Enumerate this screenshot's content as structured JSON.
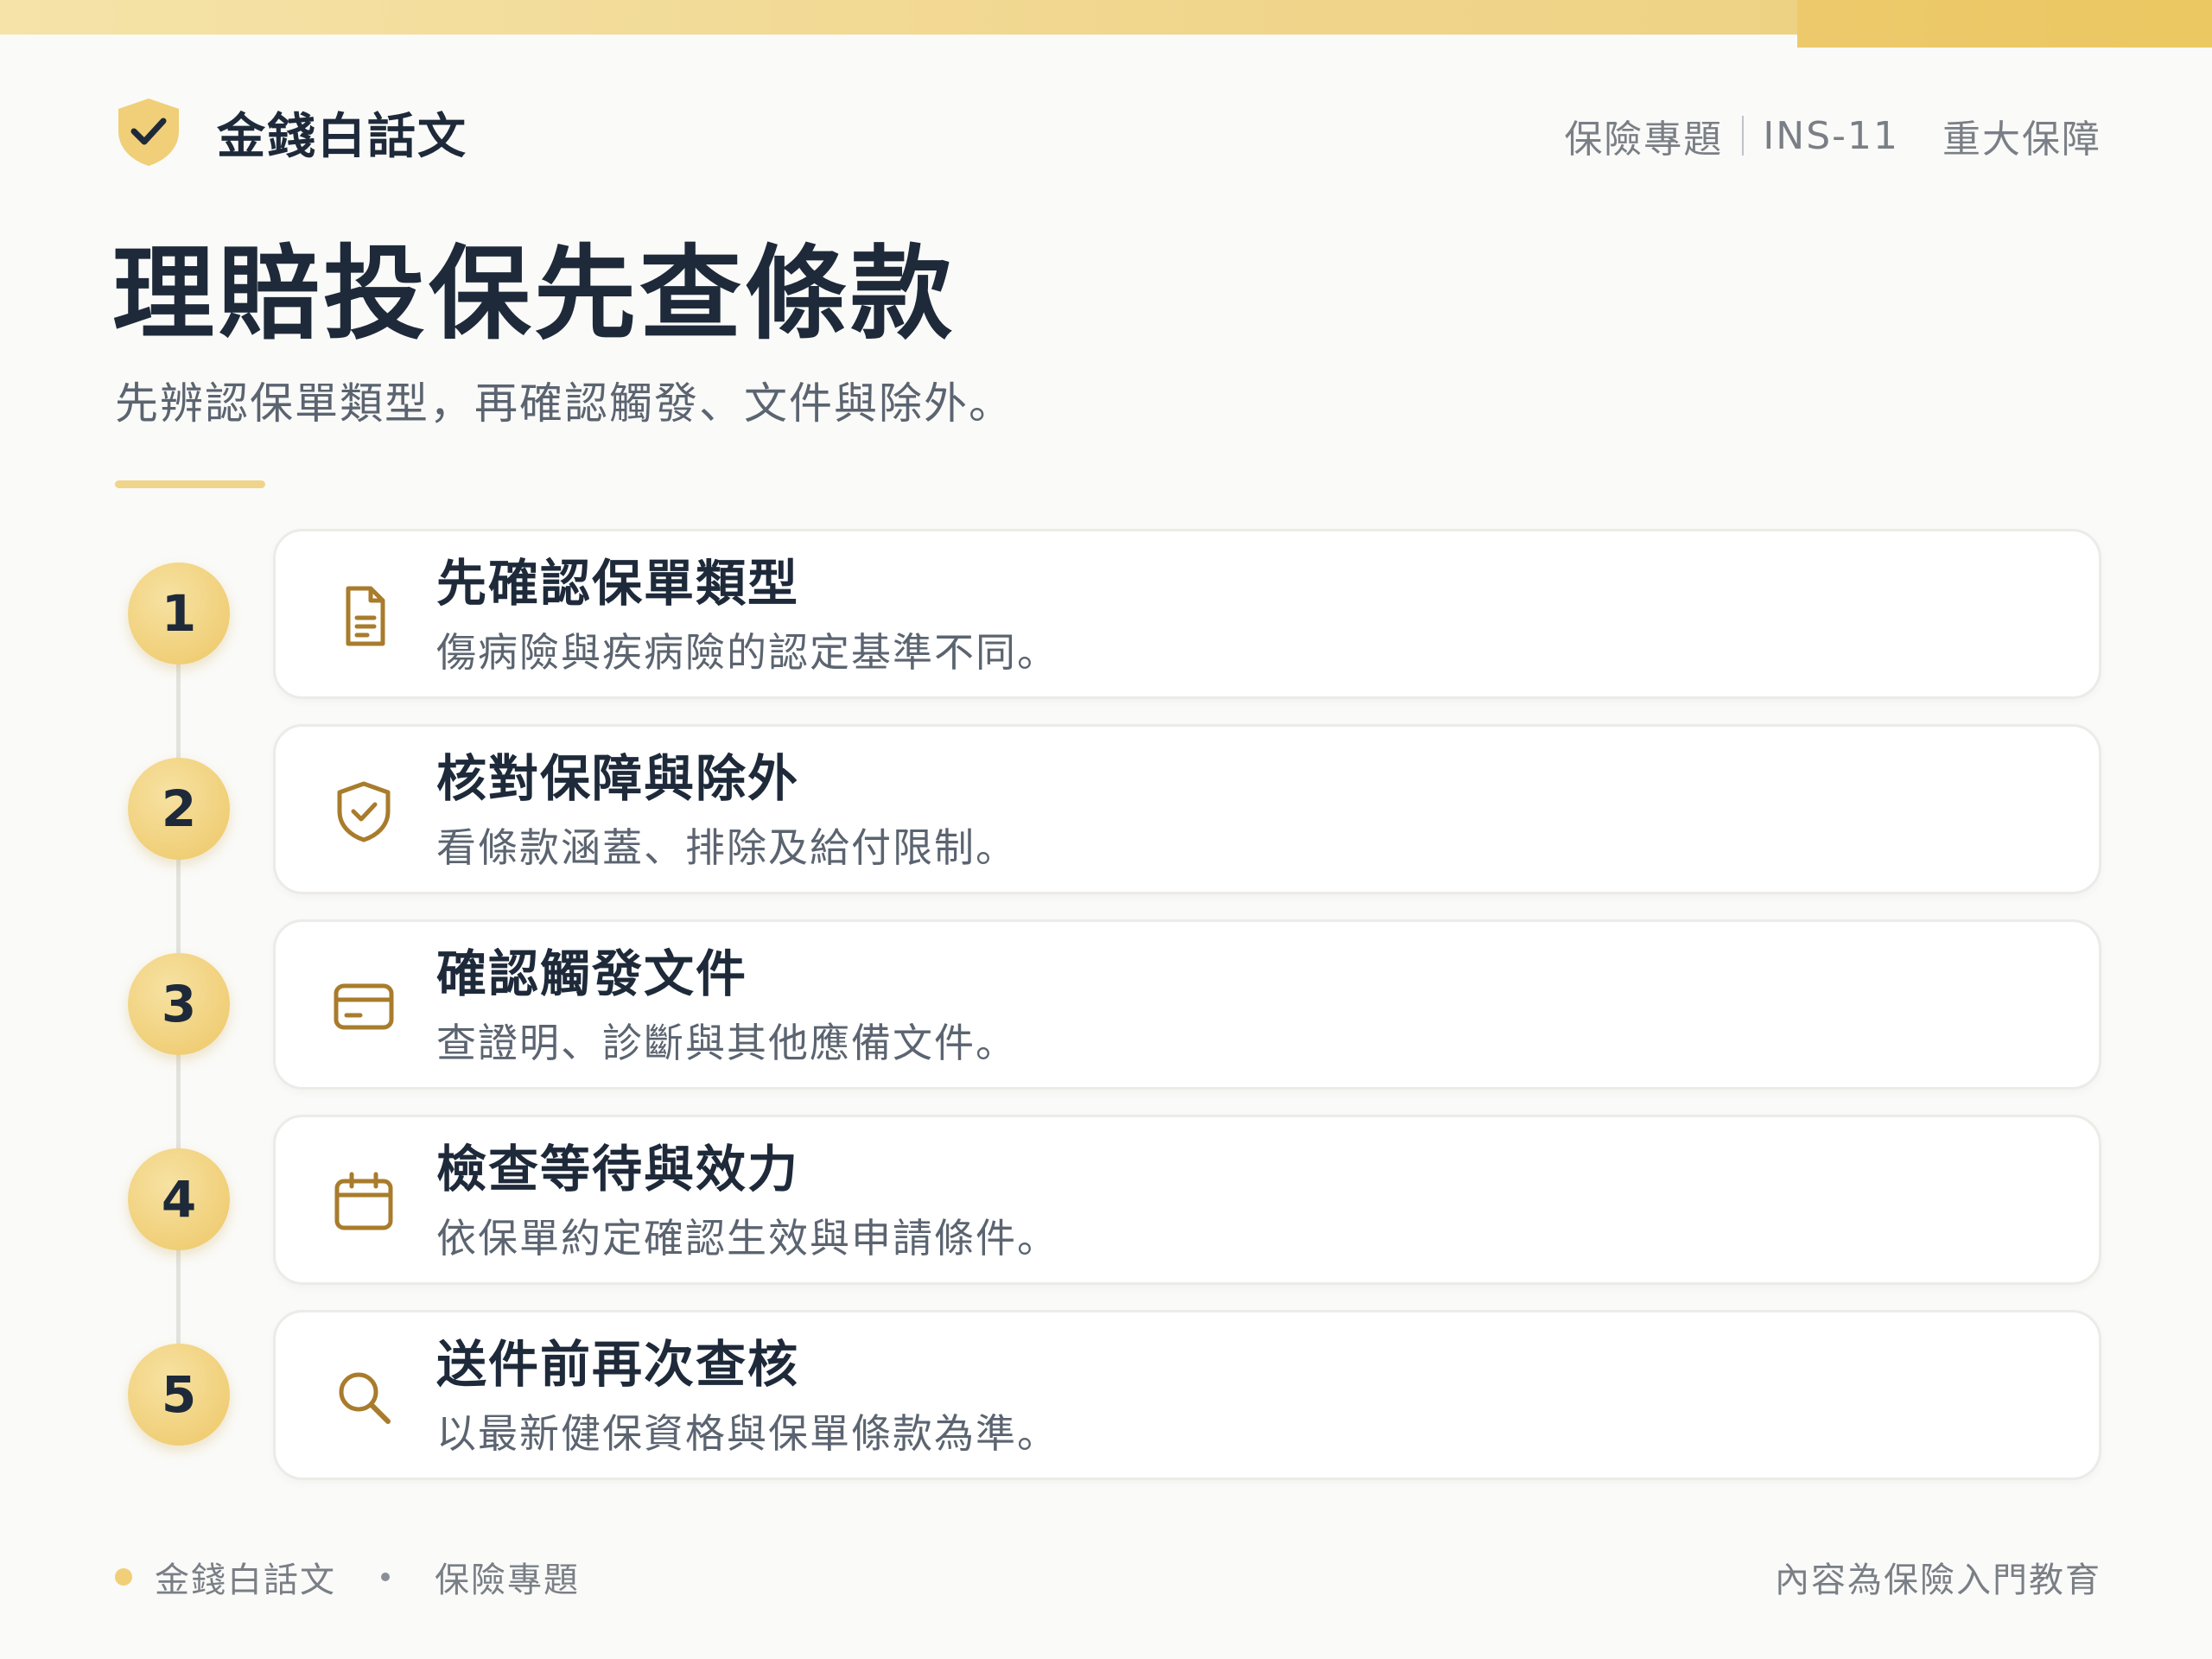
{
  "brand": {
    "name": "金錢白話文",
    "icon": "shield-check-icon"
  },
  "meta": {
    "category": "保險專題",
    "code": "INS-11",
    "tag": "重大保障"
  },
  "title": "理賠投保先查條款",
  "subtitle": "先辨認保單類型，再確認觸發、文件與除外。",
  "steps": [
    {
      "number": "1",
      "icon": "document-icon",
      "title": "先確認保單類型",
      "desc": "傷病險與疾病險的認定基準不同。"
    },
    {
      "number": "2",
      "icon": "shield-check-icon",
      "title": "核對保障與除外",
      "desc": "看條款涵蓋、排除及給付限制。"
    },
    {
      "number": "3",
      "icon": "card-icon",
      "title": "確認觸發文件",
      "desc": "查證明、診斷與其他應備文件。"
    },
    {
      "number": "4",
      "icon": "calendar-icon",
      "title": "檢查等待與效力",
      "desc": "依保單約定確認生效與申請條件。"
    },
    {
      "number": "5",
      "icon": "search-icon",
      "title": "送件前再次查核",
      "desc": "以最新健保資格與保單條款為準。"
    }
  ],
  "footer": {
    "brand": "金錢白話文",
    "category": "保險專題",
    "note": "內容為保險入門教育"
  },
  "colors": {
    "accent": "#f0cf78",
    "icon": "#a87c2c",
    "text": "#1e2a3a",
    "muted": "#5b6470"
  }
}
